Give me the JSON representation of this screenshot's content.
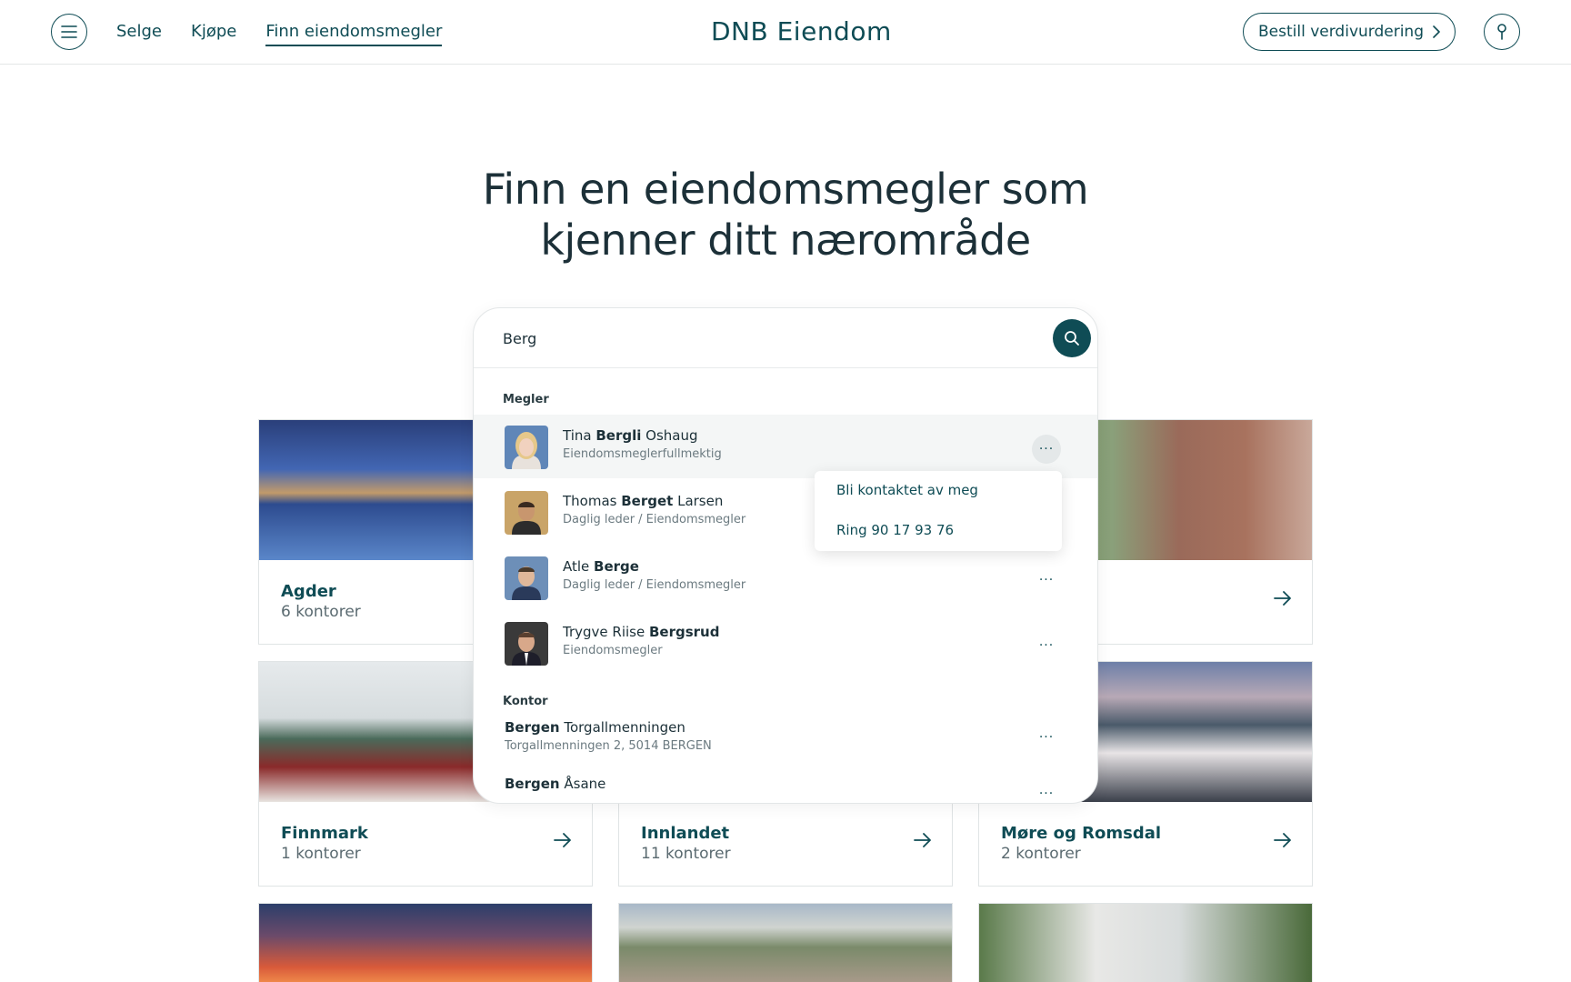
{
  "header": {
    "nav": [
      "Selge",
      "Kjøpe",
      "Finn eiendomsmegler"
    ],
    "logo": "DNB Eiendom",
    "cta_label": "Bestill verdivurdering"
  },
  "hero": {
    "title_line1": "Finn en eiendomsmegler som",
    "title_line2": "kjenner ditt nærområde"
  },
  "search": {
    "value": "Berg",
    "section_brokers": "Megler",
    "section_offices": "Kontor",
    "brokers": [
      {
        "pre": "Tina ",
        "match": "Bergli",
        "post": " Oshaug",
        "role": "Eiendomsmeglerfullmektig"
      },
      {
        "pre": "Thomas ",
        "match": "Berget",
        "post": " Larsen",
        "role": "Daglig leder / Eiendomsmegler"
      },
      {
        "pre": "Atle ",
        "match": "Berge",
        "post": "",
        "role": "Daglig leder / Eiendomsmegler"
      },
      {
        "pre": "Trygve Riise ",
        "match": "Bergsrud",
        "post": "",
        "role": "Eiendomsmegler"
      }
    ],
    "offices": [
      {
        "match": "Bergen",
        "post": " Torgallmenningen",
        "address": "Torgallmenningen 2, 5014 BERGEN"
      },
      {
        "match": "Bergen",
        "post": " Åsane",
        "address": ""
      }
    ],
    "more_label": "···"
  },
  "popup": {
    "contact": "Bli kontaktet av meg",
    "call": "Ring 90 17 93 76"
  },
  "regions": [
    {
      "name": "Agder",
      "count": "6 kontorer"
    },
    {
      "name": "Finnmark",
      "count": "1 kontorer"
    },
    {
      "name": "Innlandet",
      "count": "11 kontorer"
    },
    {
      "name": "Møre og Romsdal",
      "count": "2 kontorer"
    }
  ],
  "colors": {
    "brand": "#0f4c55"
  }
}
